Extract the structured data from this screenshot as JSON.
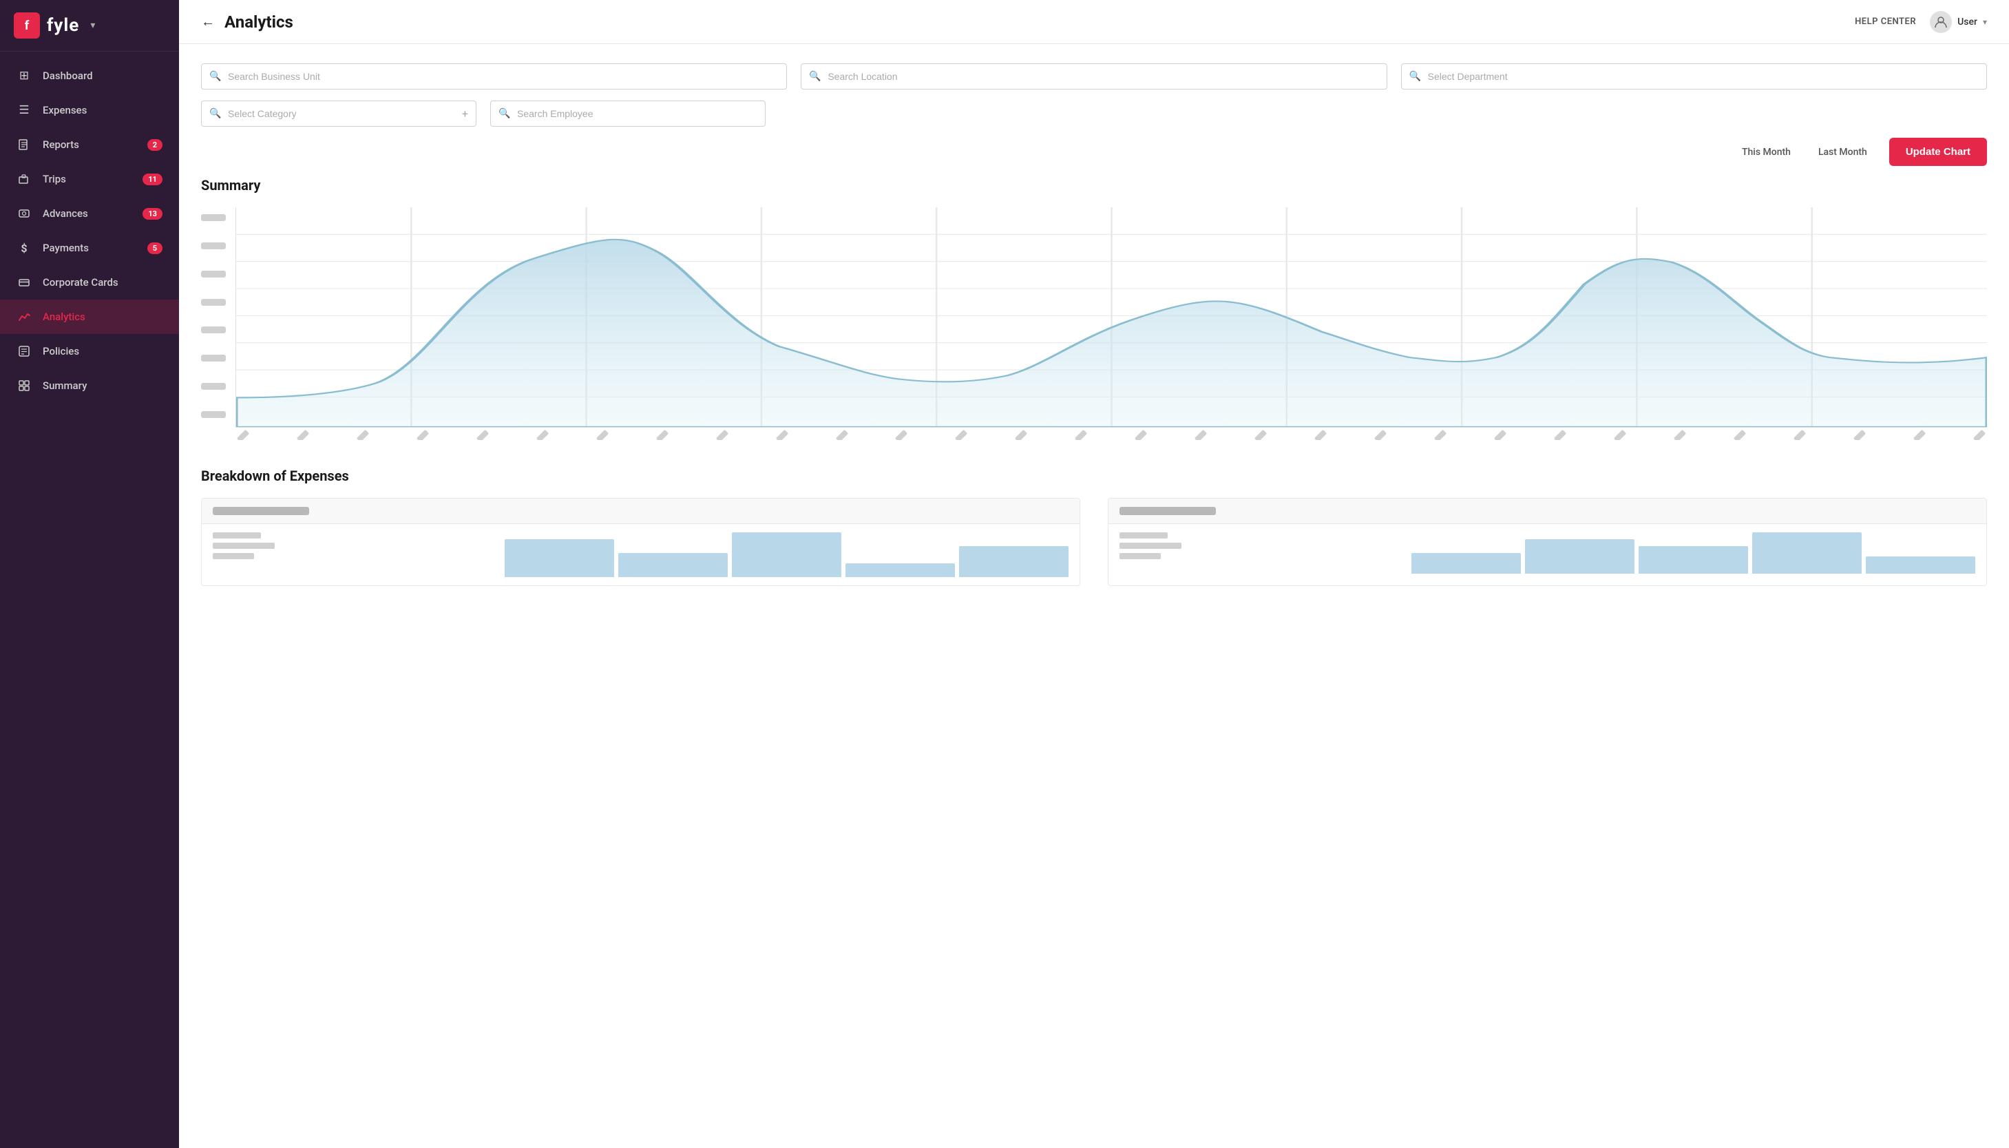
{
  "app": {
    "logo_letter": "f",
    "logo_text": "fyle"
  },
  "header": {
    "back_label": "←",
    "title": "Analytics",
    "help_center": "HELP CENTER",
    "user": "User"
  },
  "filters": {
    "row1": [
      {
        "placeholder": "Search Business Unit",
        "id": "business-unit"
      },
      {
        "placeholder": "Search Location",
        "id": "location"
      },
      {
        "placeholder": "Select Department",
        "id": "department"
      }
    ],
    "row2": [
      {
        "placeholder": "Select Category",
        "id": "category",
        "has_plus": true
      },
      {
        "placeholder": "Search Employee",
        "id": "employee"
      }
    ]
  },
  "time_controls": {
    "this_month": "This Month",
    "last_month": "Last Month",
    "update_chart": "Update Chart"
  },
  "summary": {
    "title": "Summary",
    "chart_x_labels": [
      "",
      "",
      "",
      "",
      "",
      "",
      "",
      "",
      "",
      "",
      "",
      "",
      "",
      "",
      "",
      "",
      "",
      "",
      "",
      "",
      "",
      "",
      "",
      "",
      "",
      "",
      "",
      "",
      "",
      ""
    ]
  },
  "breakdown": {
    "title": "Breakdown of Expenses"
  },
  "sidebar": {
    "items": [
      {
        "id": "dashboard",
        "label": "Dashboard",
        "icon": "⊞",
        "badge": null,
        "active": false
      },
      {
        "id": "expenses",
        "label": "Expenses",
        "icon": "☰",
        "badge": null,
        "active": false
      },
      {
        "id": "reports",
        "label": "Reports",
        "icon": "📄",
        "badge": "2",
        "active": false
      },
      {
        "id": "trips",
        "label": "Trips",
        "icon": "💼",
        "badge": "11",
        "active": false
      },
      {
        "id": "advances",
        "label": "Advances",
        "icon": "💲",
        "badge": "13",
        "active": false
      },
      {
        "id": "payments",
        "label": "Payments",
        "icon": "$",
        "badge": "5",
        "active": false
      },
      {
        "id": "corporate-cards",
        "label": "Corporate Cards",
        "icon": "💳",
        "badge": null,
        "active": false
      },
      {
        "id": "analytics",
        "label": "Analytics",
        "icon": "〜",
        "badge": null,
        "active": true
      },
      {
        "id": "policies",
        "label": "Policies",
        "icon": "⊟",
        "badge": null,
        "active": false
      },
      {
        "id": "summary",
        "label": "Summary",
        "icon": "▦",
        "badge": null,
        "active": false
      }
    ]
  },
  "colors": {
    "sidebar_bg": "#2d1b36",
    "active_color": "#e5274a",
    "accent": "#e5274a",
    "chart_fill": "#cee7f0"
  }
}
